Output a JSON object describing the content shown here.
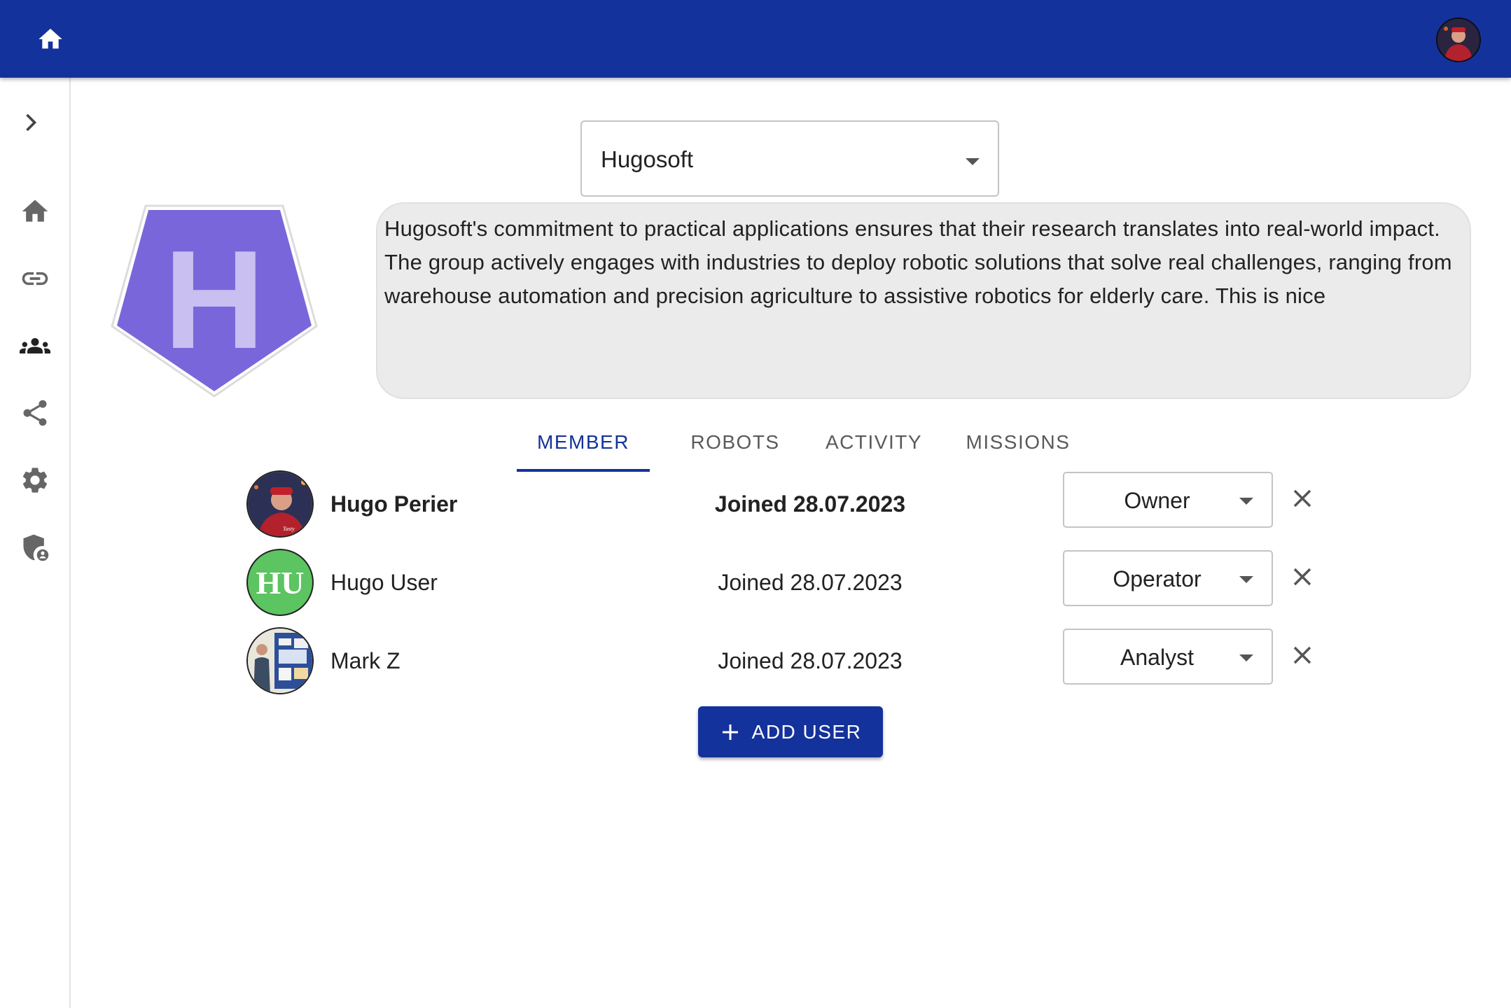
{
  "header": {
    "home_icon": "home-icon",
    "user_avatar": "user-avatar",
    "bar_color": "#14329b"
  },
  "sidebar": {
    "items": [
      {
        "icon": "chevron-right-icon"
      },
      {
        "icon": "home-icon"
      },
      {
        "icon": "link-icon"
      },
      {
        "icon": "groups-icon"
      },
      {
        "icon": "share-icon"
      },
      {
        "icon": "gear-icon"
      },
      {
        "icon": "admin-shield-icon"
      }
    ]
  },
  "organization": {
    "selected": "Hugosoft",
    "logo_letter": "H",
    "logo_color": "#7a66db",
    "description": "Hugosoft's commitment to practical applications ensures that their research translates into real-world impact. The group actively engages with industries to deploy robotic solutions that solve real challenges, ranging from warehouse automation and precision agriculture to assistive robotics for elderly care. This is nice"
  },
  "tabs": [
    {
      "label": "MEMBER",
      "active": true
    },
    {
      "label": "ROBOTS",
      "active": false
    },
    {
      "label": "ACTIVITY",
      "active": false
    },
    {
      "label": "MISSIONS",
      "active": false
    }
  ],
  "members": [
    {
      "name": "Hugo Perier",
      "joined": "Joined 28.07.2023",
      "role": "Owner",
      "avatar": "photo",
      "highlight": true
    },
    {
      "name": "Hugo User",
      "joined": "Joined 28.07.2023",
      "role": "Operator",
      "avatar_initials": "HU",
      "avatar_color": "#5cc460"
    },
    {
      "name": "Mark Z",
      "joined": "Joined 28.07.2023",
      "role": "Analyst",
      "avatar": "photo"
    }
  ],
  "actions": {
    "add_user_label": "ADD USER"
  }
}
